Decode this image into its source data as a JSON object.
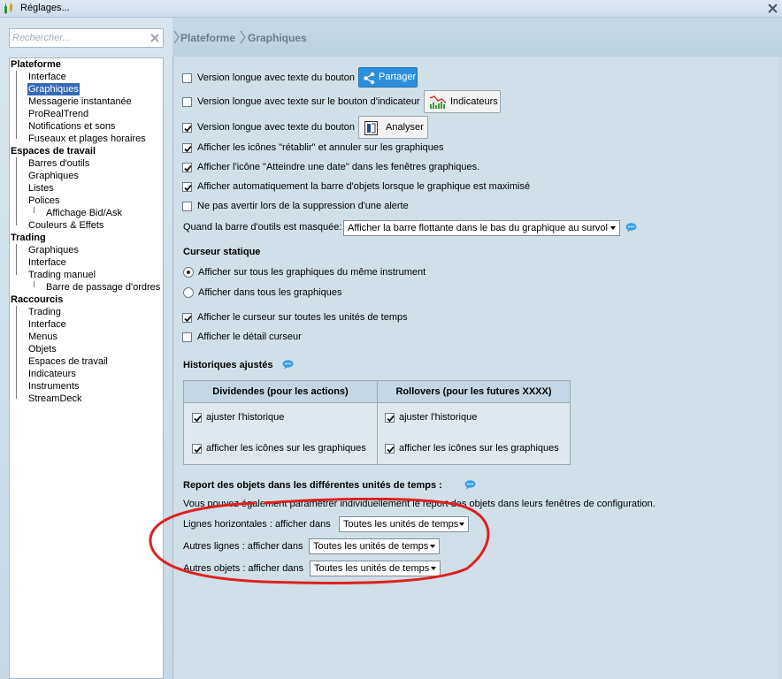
{
  "window": {
    "title": "Réglages..."
  },
  "search": {
    "placeholder": "Rechercher..."
  },
  "tree": [
    {
      "label": "Plateforme",
      "level": 0
    },
    {
      "label": "Interface",
      "level": 1
    },
    {
      "label": "Graphiques",
      "level": 1,
      "selected": true
    },
    {
      "label": "Messagerie instantanée",
      "level": 1
    },
    {
      "label": "ProRealTrend",
      "level": 1
    },
    {
      "label": "Notifications et sons",
      "level": 1
    },
    {
      "label": "Fuseaux et plages horaires",
      "level": 1
    },
    {
      "label": "Espaces de travail",
      "level": 0
    },
    {
      "label": "Barres d'outils",
      "level": 1
    },
    {
      "label": "Graphiques",
      "level": 1
    },
    {
      "label": "Listes",
      "level": 1
    },
    {
      "label": "Polices",
      "level": 1
    },
    {
      "label": "Affichage Bid/Ask",
      "level": 2
    },
    {
      "label": "Couleurs & Effets",
      "level": 1
    },
    {
      "label": "Trading",
      "level": 0
    },
    {
      "label": "Graphiques",
      "level": 1
    },
    {
      "label": "Interface",
      "level": 1
    },
    {
      "label": "Trading manuel",
      "level": 1
    },
    {
      "label": "Barre de passage d'ordres",
      "level": 2
    },
    {
      "label": "Raccourcis",
      "level": 0
    },
    {
      "label": "Trading",
      "level": 1
    },
    {
      "label": "Interface",
      "level": 1
    },
    {
      "label": "Menus",
      "level": 1
    },
    {
      "label": "Objets",
      "level": 1
    },
    {
      "label": "Espaces de travail",
      "level": 1
    },
    {
      "label": "Indicateurs",
      "level": 1
    },
    {
      "label": "Instruments",
      "level": 1
    },
    {
      "label": "StreamDeck",
      "level": 1
    }
  ],
  "breadcrumb": [
    "Plateforme",
    "Graphiques"
  ],
  "options": {
    "share_label": "Version longue avec texte du bouton",
    "share_checked": false,
    "share_button": "Partager",
    "indicator_label": "Version longue avec texte sur le bouton d'indicateur",
    "indicator_checked": false,
    "indicator_button": "Indicateurs",
    "analyse_label": "Version longue avec texte du bouton",
    "analyse_checked": true,
    "analyse_button": "Analyser",
    "undo_label": "Afficher les icônes \"rétablir\" et annuler sur les graphiques",
    "undo_checked": true,
    "goto_label": "Afficher l'icône \"Atteindre une date\" dans les fenêtres graphiques.",
    "goto_checked": true,
    "objbar_label": "Afficher automatiquement la barre d'objets lorsque le graphique est maximisé",
    "objbar_checked": true,
    "alert_label": "Ne pas avertir lors de la suppression d'une alerte",
    "alert_checked": false,
    "toolbar_hidden_label": "Quand la barre d'outils est masquée:",
    "toolbar_hidden_value": "Afficher la barre flottante dans le bas du graphique au survol"
  },
  "cursor": {
    "title": "Curseur statique",
    "radio_same": "Afficher sur tous les graphiques du même instrument",
    "radio_all": "Afficher dans tous les graphiques",
    "selected": "same",
    "all_units_label": "Afficher le curseur sur toutes les unités de temps",
    "all_units_checked": true,
    "detail_label": "Afficher le détail curseur",
    "detail_checked": false
  },
  "history": {
    "title": "Historiques ajustés",
    "col1_header": "Dividendes (pour les actions)",
    "col2_header": "Rollovers (pour les futures XXXX)",
    "adjust_label": "ajuster l'historique",
    "icons_label": "afficher les icônes sur les graphiques",
    "col1_adjust_checked": true,
    "col1_icons_checked": true,
    "col2_adjust_checked": true,
    "col2_icons_checked": true
  },
  "report": {
    "title": "Report des objets dans les différentes unités de temps :",
    "note": "Vous pouvez également paramétrer individuellement le report des objets dans leurs fenêtres de configuration.",
    "hlines_label": "Lignes horizontales :  afficher dans",
    "hlines_value": "Toutes les unités de temps",
    "otherlines_label": "Autres lignes : afficher dans",
    "otherlines_value": "Toutes les unités de temps",
    "otherobjs_label": "Autres objets : afficher dans",
    "otherobjs_value": "Toutes les unités de temps"
  },
  "colors": {
    "accent": "#2b8fdb",
    "selection": "#3469b8",
    "annotation": "#e02020"
  }
}
